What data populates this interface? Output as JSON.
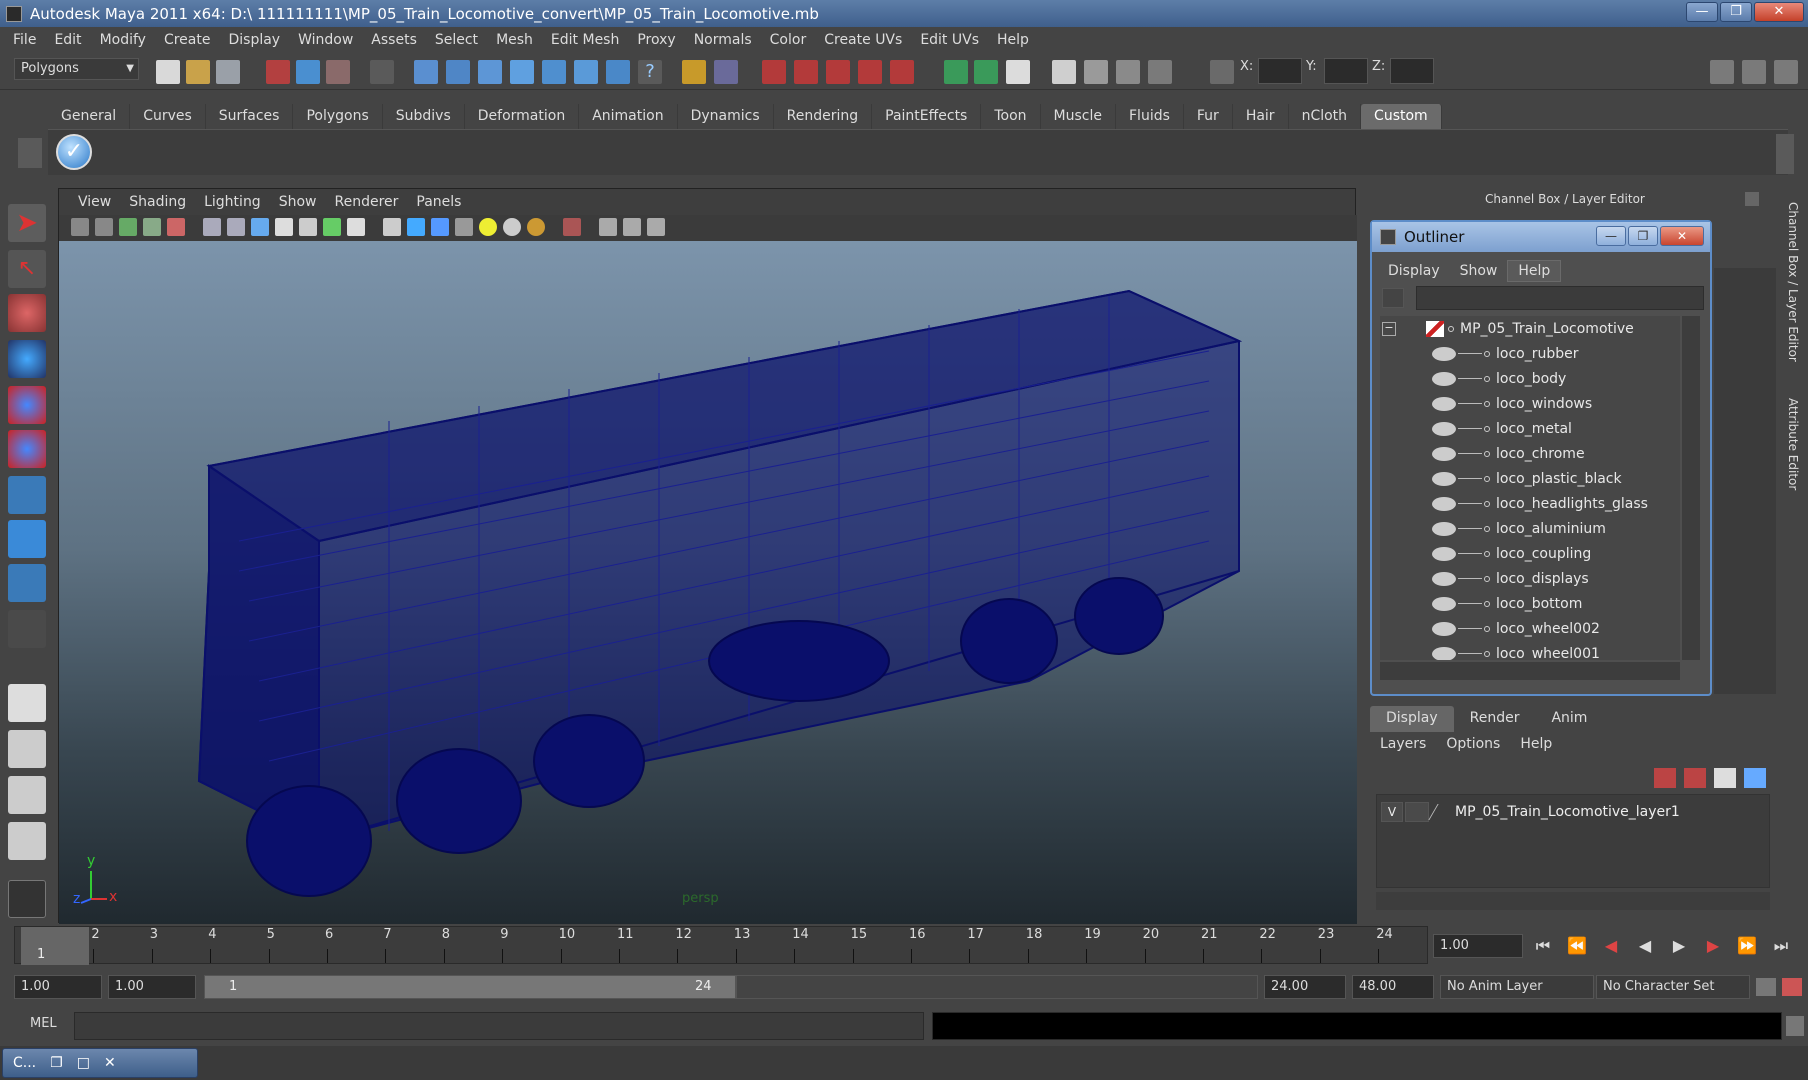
{
  "window": {
    "title": "Autodesk Maya 2011 x64: D:\\ 111111111\\MP_05_Train_Locomotive_convert\\MP_05_Train_Locomotive.mb",
    "min_label": "—",
    "max_label": "❐",
    "close_label": "✕"
  },
  "menubar": [
    "File",
    "Edit",
    "Modify",
    "Create",
    "Display",
    "Window",
    "Assets",
    "Select",
    "Mesh",
    "Edit Mesh",
    "Proxy",
    "Normals",
    "Color",
    "Create UVs",
    "Edit UVs",
    "Help"
  ],
  "statusline": {
    "mode": "Polygons",
    "x_label": "X:",
    "y_label": "Y:",
    "z_label": "Z:"
  },
  "shelf": {
    "tabs": [
      "General",
      "Curves",
      "Surfaces",
      "Polygons",
      "Subdivs",
      "Deformation",
      "Animation",
      "Dynamics",
      "Rendering",
      "PaintEffects",
      "Toon",
      "Muscle",
      "Fluids",
      "Fur",
      "Hair",
      "nCloth",
      "Custom"
    ],
    "active_tab": "Custom"
  },
  "viewport": {
    "menu": [
      "View",
      "Shading",
      "Lighting",
      "Show",
      "Renderer",
      "Panels"
    ],
    "camera_label": "persp",
    "axis_y": "y",
    "axis_x": "x",
    "axis_z": "z",
    "mesh_color": "#0a0f6b"
  },
  "channel_box": {
    "header": "Channel Box / Layer Editor",
    "side_tab_1": "Channel Box / Layer Editor",
    "side_tab_2": "Attribute Editor"
  },
  "outliner": {
    "title": "Outliner",
    "menu": [
      "Display",
      "Show",
      "Help"
    ],
    "root": "MP_05_Train_Locomotive",
    "items": [
      "loco_rubber",
      "loco_body",
      "loco_windows",
      "loco_metal",
      "loco_chrome",
      "loco_plastic_black",
      "loco_headlights_glass",
      "loco_aluminium",
      "loco_coupling",
      "loco_displays",
      "loco_bottom",
      "loco_wheel002",
      "loco_wheel001"
    ]
  },
  "layer_editor": {
    "tabs": [
      "Display",
      "Render",
      "Anim"
    ],
    "active_tab": "Display",
    "menu": [
      "Layers",
      "Options",
      "Help"
    ],
    "visible_flag": "V",
    "layer_name": "MP_05_Train_Locomotive_layer1"
  },
  "timeline": {
    "frames": [
      "1",
      "2",
      "3",
      "4",
      "5",
      "6",
      "7",
      "8",
      "9",
      "10",
      "11",
      "12",
      "13",
      "14",
      "15",
      "16",
      "17",
      "18",
      "19",
      "20",
      "21",
      "22",
      "23",
      "24"
    ],
    "current_frame_marker": "1",
    "current_frame": "1.00"
  },
  "range": {
    "start": "1.00",
    "playback_start": "1.00",
    "range_start": "1",
    "range_end": "24",
    "playback_end": "24.00",
    "end": "48.00",
    "anim_layer": "No Anim Layer",
    "character_set": "No Character Set"
  },
  "command_line": {
    "label": "MEL"
  },
  "taskbar": {
    "window_label": "C..."
  }
}
